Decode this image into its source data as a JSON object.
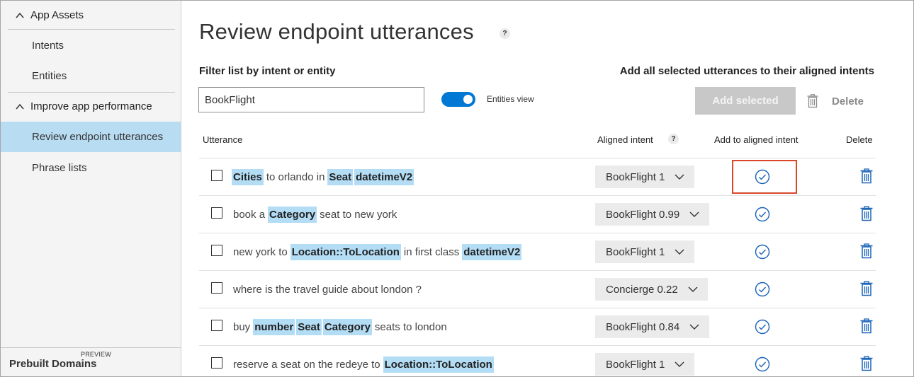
{
  "sidebar": {
    "sections": [
      {
        "label": "App Assets"
      },
      {
        "label": "Improve app performance"
      }
    ],
    "items": [
      {
        "label": "Intents"
      },
      {
        "label": "Entities"
      },
      {
        "label": "Review endpoint utterances",
        "active": true
      },
      {
        "label": "Phrase lists"
      }
    ],
    "bottom": {
      "label": "Prebuilt Domains",
      "badge": "PREVIEW"
    }
  },
  "page": {
    "title": "Review endpoint utterances",
    "help_glyph": "?"
  },
  "filter": {
    "label": "Filter list by intent or entity",
    "value": "BookFlight",
    "toggle_label": "Entities view",
    "toggle_on": true
  },
  "actions": {
    "label": "Add all selected utterances to their aligned intents",
    "add_selected": "Add selected",
    "delete": "Delete"
  },
  "table": {
    "headers": {
      "utterance": "Utterance",
      "aligned_intent": "Aligned intent",
      "add_to_aligned": "Add to aligned intent",
      "delete": "Delete"
    },
    "rows": [
      {
        "tokens": [
          {
            "e": "Cities"
          },
          {
            "t": "to orlando in"
          },
          {
            "e": "Seat"
          },
          {
            "e": "datetimeV2"
          }
        ],
        "intent": "BookFlight 1"
      },
      {
        "tokens": [
          {
            "t": "book a"
          },
          {
            "e": "Category"
          },
          {
            "t": "seat to new york"
          }
        ],
        "intent": "BookFlight 0.99"
      },
      {
        "tokens": [
          {
            "t": "new york to"
          },
          {
            "e": "Location::ToLocation"
          },
          {
            "t": "in first class"
          },
          {
            "e": "datetimeV2"
          }
        ],
        "intent": "BookFlight 1"
      },
      {
        "tokens": [
          {
            "t": "where is the travel guide about london ?"
          }
        ],
        "intent": "Concierge 0.22"
      },
      {
        "tokens": [
          {
            "t": "buy"
          },
          {
            "e": "number"
          },
          {
            "e": "Seat"
          },
          {
            "e": "Category"
          },
          {
            "t": "seats to london"
          }
        ],
        "intent": "BookFlight 0.84"
      },
      {
        "tokens": [
          {
            "t": "reserve a seat on the redeye to"
          },
          {
            "e": "Location::ToLocation"
          }
        ],
        "intent": "BookFlight 1"
      }
    ]
  },
  "colors": {
    "accent": "#0078d4",
    "entity_highlight": "#b3dcf5",
    "sidebar_active": "#b8dcf2",
    "callout_box": "#d9472b"
  },
  "icons": {
    "section_chevron": "chevron-up-icon",
    "dropdown": "chevron-down-icon",
    "add": "check-circle-icon",
    "delete": "trash-icon"
  }
}
